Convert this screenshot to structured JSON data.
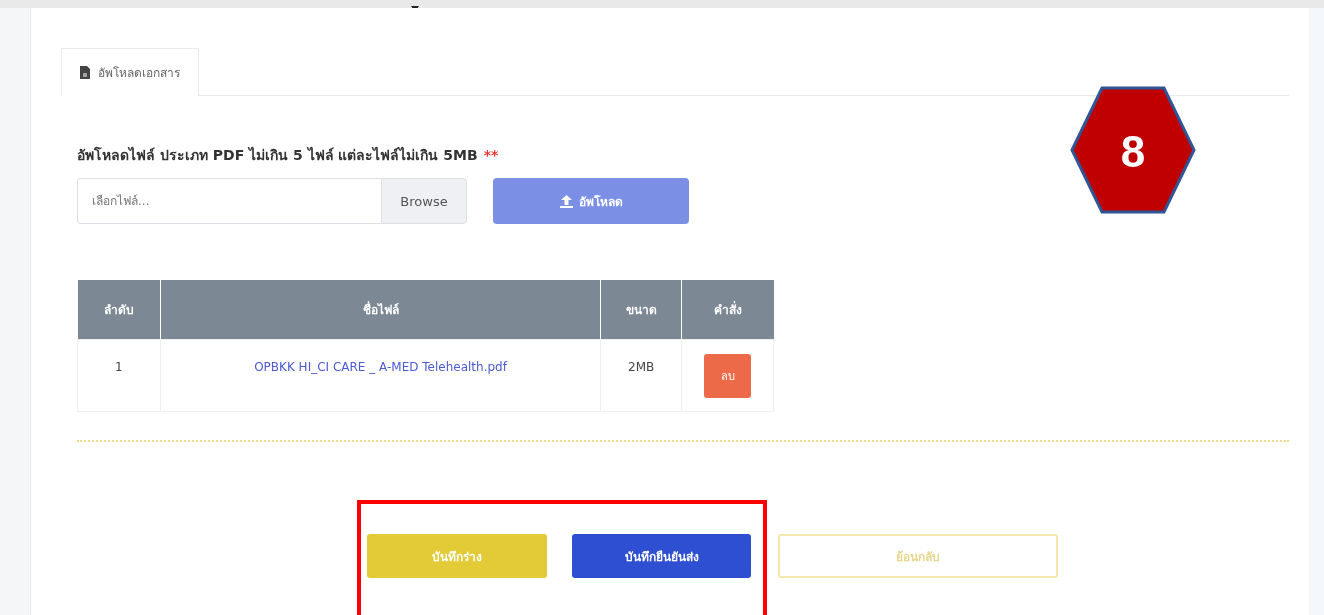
{
  "tabs": [
    {
      "label": "อัพโหลดเอกสาร",
      "selected": true
    }
  ],
  "upload": {
    "heading": "อัพโหลดไฟล์ ประเภท PDF ไม่เกิน 5 ไฟล์ แต่ละไฟล์ไม่เกิน 5MB",
    "required_mark": "**",
    "placeholder": "เลือกไฟล์...",
    "browse": "Browse",
    "button": "อัพโหลด"
  },
  "table": {
    "columns": [
      "ลำดับ",
      "ชื่อไฟล์",
      "ขนาด",
      "คำสั่ง"
    ],
    "rows": [
      {
        "index": "1",
        "file": "OPBKK HI_CI CARE _ A-MED Telehealth.pdf",
        "size": "2MB",
        "action": "ลบ"
      }
    ]
  },
  "buttons": [
    {
      "label": "บันทึกร่าง",
      "kind": "draft"
    },
    {
      "label": "บันทึกยืนยันส่ง",
      "kind": "submit"
    },
    {
      "label": "ย้อนกลับ",
      "kind": "back"
    }
  ],
  "step_badge": "8"
}
